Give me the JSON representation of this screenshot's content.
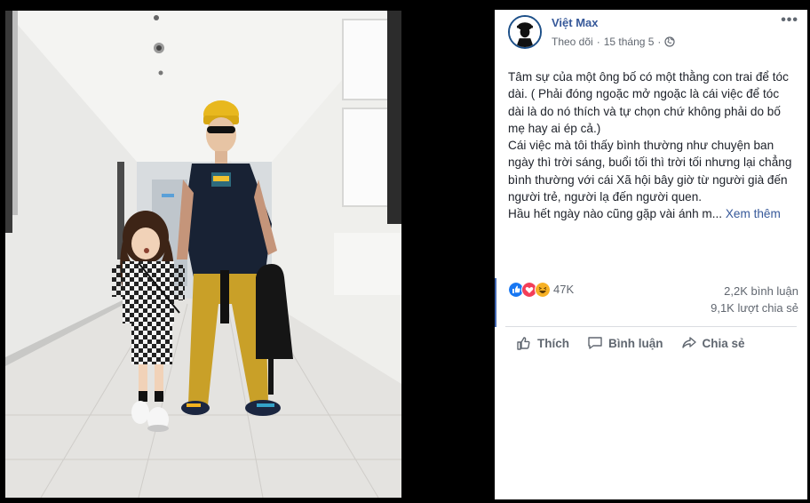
{
  "post": {
    "author": "Việt Max",
    "follow_label": "Theo dõi",
    "separator": "·",
    "date": "15 tháng 5",
    "more_label": "•••",
    "paragraphs": [
      "Tâm sự của một ông bố có một thằng con trai để tóc dài. ( Phải đóng ngoặc mở ngoặc là cái việc để tóc dài là do nó thích và tự chọn chứ không phải do bố mẹ hay ai ép cả.)",
      "Cái việc mà tôi thấy bình thường như chuyện ban ngày thì trời sáng, buổi tối thì trời tối nhưng lại chẳng bình thường với cái Xã hội bây giờ từ người già đến người trẻ, người lạ đến người quen."
    ],
    "truncated_line": "Hầu hết ngày nào cũng gặp vài ánh m...",
    "see_more": "Xem thêm"
  },
  "stats": {
    "reactions": "47K",
    "comments": "2,2K bình luận",
    "shares": "9,1K lượt chia sẻ"
  },
  "actions": {
    "like": "Thích",
    "comment": "Bình luận",
    "share": "Chia sẻ"
  },
  "reaction_icons": [
    "like-icon",
    "love-icon",
    "haha-icon"
  ],
  "colors": {
    "link": "#365899",
    "like_blue": "#1877f2",
    "love_red": "#f33e58",
    "haha_yellow": "#f7b125",
    "beanie_yellow": "#e8b81e",
    "pants_mustard": "#c9a028"
  }
}
